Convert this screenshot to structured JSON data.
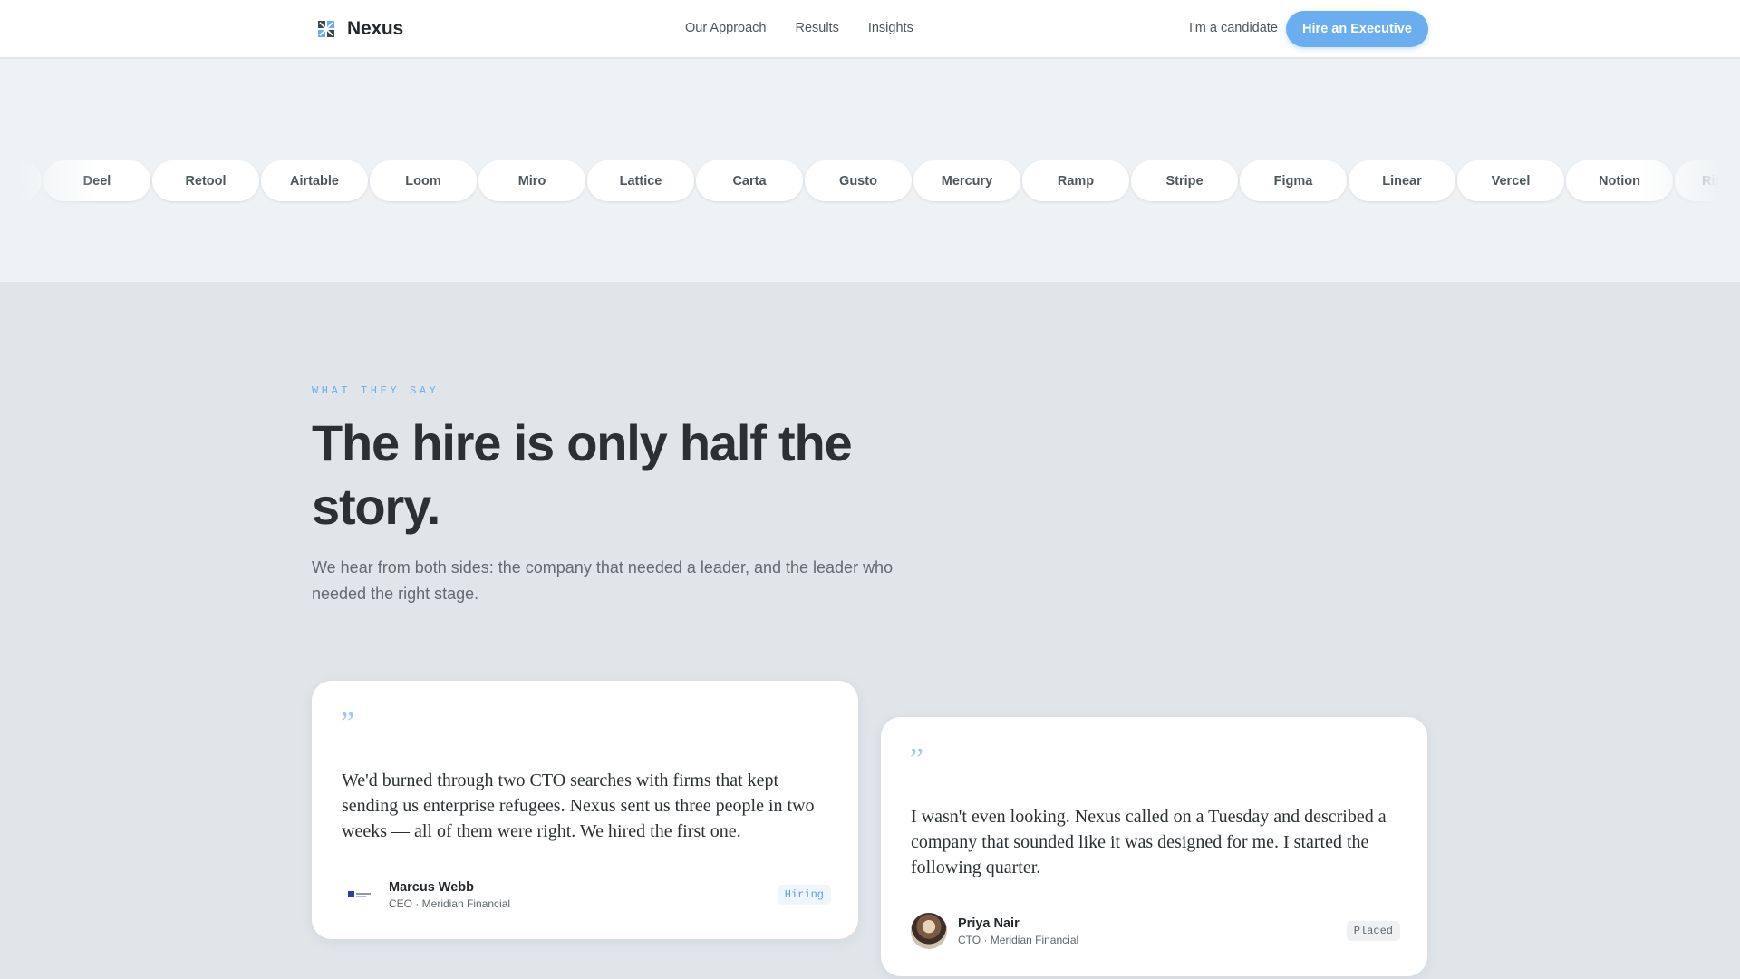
{
  "header": {
    "brand_name": "Nexus",
    "nav": [
      "Our Approach",
      "Results",
      "Insights"
    ],
    "candidate_link": "I'm a candidate",
    "cta": "Hire an Executive"
  },
  "logos": [
    "",
    "Deel",
    "Retool",
    "Airtable",
    "Loom",
    "Miro",
    "Lattice",
    "Carta",
    "Gusto",
    "Mercury",
    "Ramp",
    "Stripe",
    "Figma",
    "Linear",
    "Vercel",
    "Notion",
    "Rippling"
  ],
  "testimonials_section": {
    "eyebrow": "WHAT THEY SAY",
    "headline": "The hire is only half the story.",
    "subhead": "We hear from both sides: the company that needed a leader, and the leader who needed the right stage."
  },
  "testimonials": [
    {
      "quote_mark": "”",
      "quote": "We'd burned through two CTO searches with firms that kept sending us enterprise refugees. Nexus sent us three people in two weeks — all of them were right. We hired the first one.",
      "name": "Marcus Webb",
      "role": "CEO · Meridian Financial",
      "badge": "Hiring"
    },
    {
      "quote_mark": "”",
      "quote": "I wasn't even looking. Nexus called on a Tuesday and described a company that sounded like it was designed for me. I started the following quarter.",
      "name": "Priya Nair",
      "role": "CTO · Meridian Financial",
      "badge": "Placed"
    }
  ],
  "colors": {
    "accent": "#6aaef0",
    "page_bg": "#dfe5e9",
    "strip_bg": "#eff2f4",
    "text": "#2b3033"
  },
  "icons": {
    "brand": "nexus-grid-logo-icon",
    "company_avatar": "meridian-logo-icon"
  }
}
